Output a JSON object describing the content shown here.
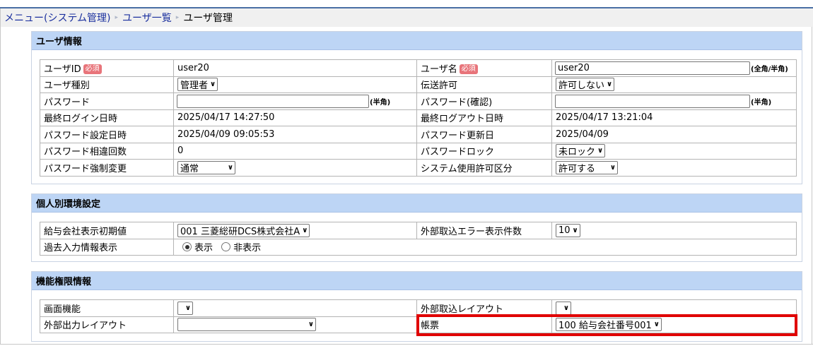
{
  "breadcrumb": {
    "items": [
      "メニュー(システム管理)",
      "ユーザ一覧"
    ],
    "current": "ユーザ管理",
    "separator": "▸"
  },
  "user_info": {
    "title": "ユーザ情報",
    "required_badge": "必須",
    "user_id_label": "ユーザID",
    "user_id_value": "user20",
    "user_name_label": "ユーザ名",
    "user_name_value": "user20",
    "user_name_hint": "(全角/半角)",
    "user_type_label": "ユーザ種別",
    "user_type_value": "管理者",
    "transfer_label": "伝送許可",
    "transfer_value": "許可しない",
    "password_label": "パスワード",
    "password_hint": "(半角)",
    "password_confirm_label": "パスワード(確認)",
    "password_confirm_hint": "(半角)",
    "last_login_label": "最終ログイン日時",
    "last_login_value": "2025/04/17 14:27:50",
    "last_logout_label": "最終ログアウト日時",
    "last_logout_value": "2025/04/17 13:21:04",
    "pw_set_label": "パスワード設定日時",
    "pw_set_value": "2025/04/09 09:05:53",
    "pw_update_label": "パスワード更新日",
    "pw_update_value": "2025/04/09",
    "pw_mismatch_label": "パスワード相違回数",
    "pw_mismatch_value": "0",
    "pw_lock_label": "パスワードロック",
    "pw_lock_value": "未ロック",
    "pw_force_label": "パスワード強制変更",
    "pw_force_value": "通常",
    "system_use_label": "システム使用許可区分",
    "system_use_value": "許可する"
  },
  "personal_env": {
    "title": "個人別環境設定",
    "company_label": "給与会社表示初期値",
    "company_value": "001 三菱総研DCS株式会社A",
    "import_error_label": "外部取込エラー表示件数",
    "import_error_value": "10",
    "past_input_label": "過去入力情報表示",
    "show_label": "表示",
    "hide_label": "非表示",
    "selected": "show"
  },
  "permissions": {
    "title": "機能権限情報",
    "screen_label": "画面機能",
    "screen_value": "",
    "import_layout_label": "外部取込レイアウト",
    "import_layout_value": "",
    "export_layout_label": "外部出力レイアウト",
    "export_layout_value": "",
    "form_label": "帳票",
    "form_value": "100 給与会社番号001"
  },
  "colors": {
    "section_header": "#bdd5f5",
    "required_badge": "#e8747a",
    "highlight": "#e00000",
    "link": "#1a2f9e"
  }
}
